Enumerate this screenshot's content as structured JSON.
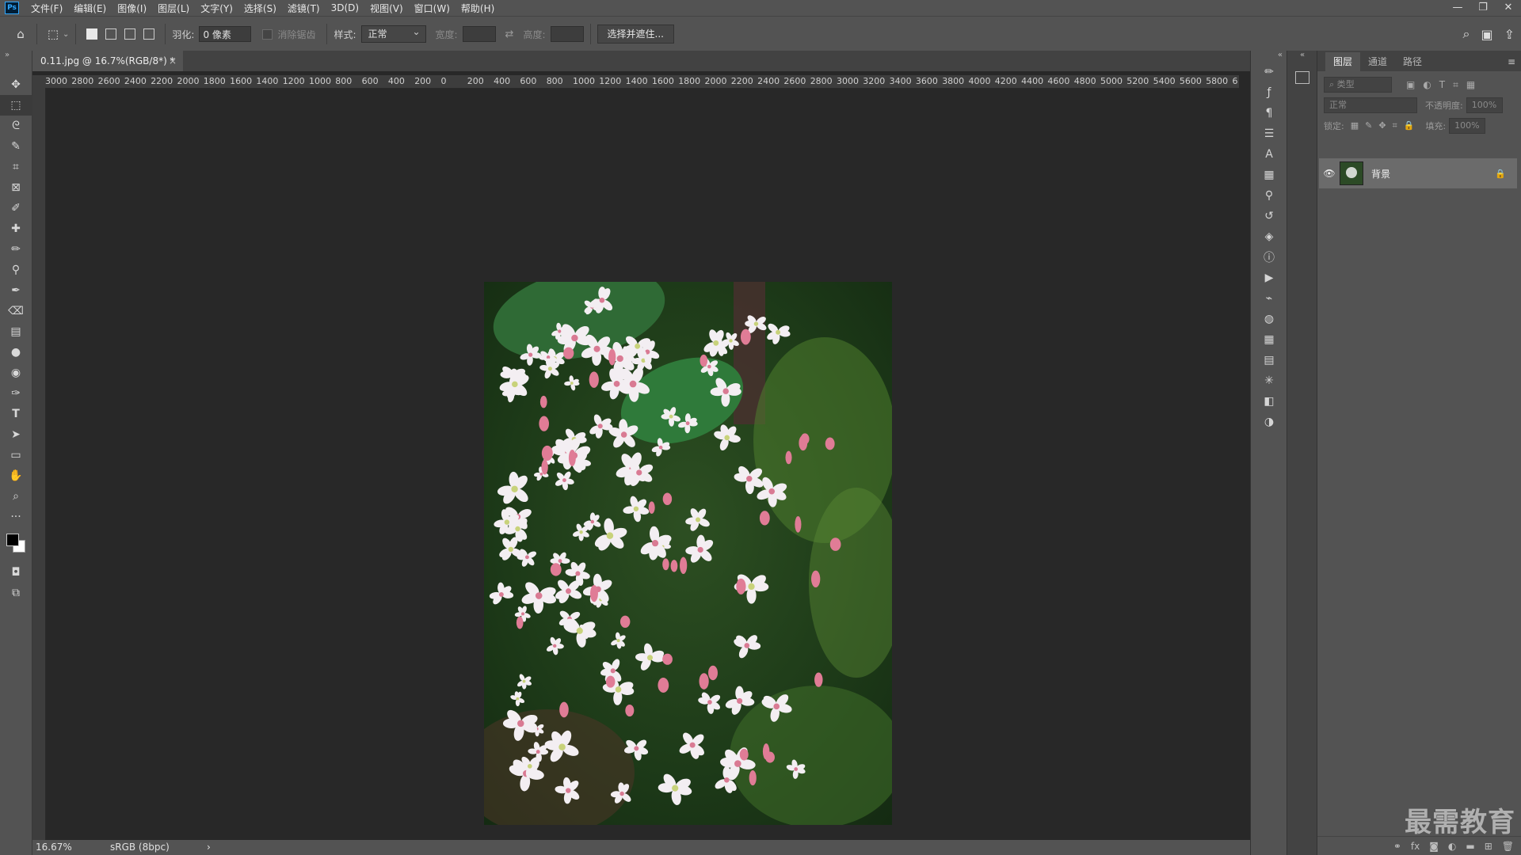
{
  "app": {
    "logo": "Ps"
  },
  "menu": [
    "文件(F)",
    "编辑(E)",
    "图像(I)",
    "图层(L)",
    "文字(Y)",
    "选择(S)",
    "滤镜(T)",
    "3D(D)",
    "视图(V)",
    "窗口(W)",
    "帮助(H)"
  ],
  "window_controls": {
    "minimize": "—",
    "restore": "❐",
    "close": "✕"
  },
  "options": {
    "feather_label": "羽化:",
    "feather_value": "0 像素",
    "antialias_label": "消除锯齿",
    "style_label": "样式:",
    "style_value": "正常",
    "width_label": "宽度:",
    "height_label": "高度:",
    "select_mask_button": "选择并遮住..."
  },
  "document": {
    "tab_title": "0.11.jpg @ 16.7%(RGB/8*) *",
    "tab_close": "×",
    "zoom": "16.67%",
    "color_profile": "sRGB (8bpc)",
    "status_arrow": "›"
  },
  "ruler_h": [
    "3000",
    "2800",
    "2600",
    "2400",
    "2200",
    "2000",
    "1800",
    "1600",
    "1400",
    "1200",
    "1000",
    "800",
    "600",
    "400",
    "200",
    "0",
    "200",
    "400",
    "600",
    "800",
    "1000",
    "1200",
    "1400",
    "1600",
    "1800",
    "2000",
    "2200",
    "2400",
    "2600",
    "2800",
    "3000",
    "3200",
    "3400",
    "3600",
    "3800",
    "4000",
    "4200",
    "4400",
    "4600",
    "4800",
    "5000",
    "5200",
    "5400",
    "5600",
    "5800",
    "6"
  ],
  "layers_panel": {
    "tabs": [
      "图层",
      "通道",
      "路径"
    ],
    "filter_placeholder": "类型",
    "blend_mode": "正常",
    "opacity_label": "不透明度:",
    "opacity_value": "100%",
    "lock_label": "锁定:",
    "fill_label": "填充:",
    "fill_value": "100%",
    "layers": [
      {
        "name": "背景",
        "visible": true,
        "locked": true
      }
    ]
  },
  "watermark": "最需教育",
  "colors": {
    "bg": "#282828",
    "panel": "#535353",
    "foreground": "#000000",
    "background": "#ffffff"
  }
}
